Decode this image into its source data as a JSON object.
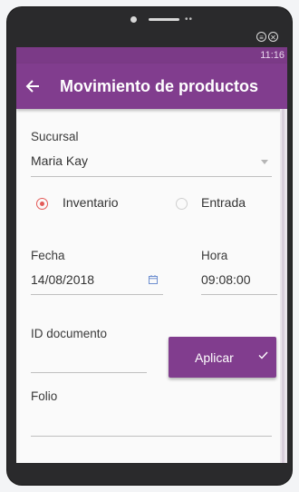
{
  "status_bar": {
    "time": "11:16"
  },
  "app_bar": {
    "title": "Movimiento de productos",
    "back_icon": "arrow-left-icon"
  },
  "form": {
    "sucursal": {
      "label": "Sucursal",
      "value": "Maria Kay"
    },
    "radio": {
      "options": [
        {
          "label": "Inventario",
          "selected": true
        },
        {
          "label": "Entrada",
          "selected": false
        }
      ]
    },
    "fecha": {
      "label": "Fecha",
      "value": "14/08/2018",
      "icon": "calendar-icon"
    },
    "hora": {
      "label": "Hora",
      "value": "09:08:00"
    },
    "id_documento": {
      "label": "ID documento",
      "value": ""
    },
    "apply_button": {
      "label": "Aplicar",
      "icon": "check-icon"
    },
    "folio": {
      "label": "Folio",
      "value": ""
    }
  },
  "colors": {
    "primary": "#813d8e",
    "status_bar": "#7b3a87",
    "radio_accent": "#e35a57"
  }
}
